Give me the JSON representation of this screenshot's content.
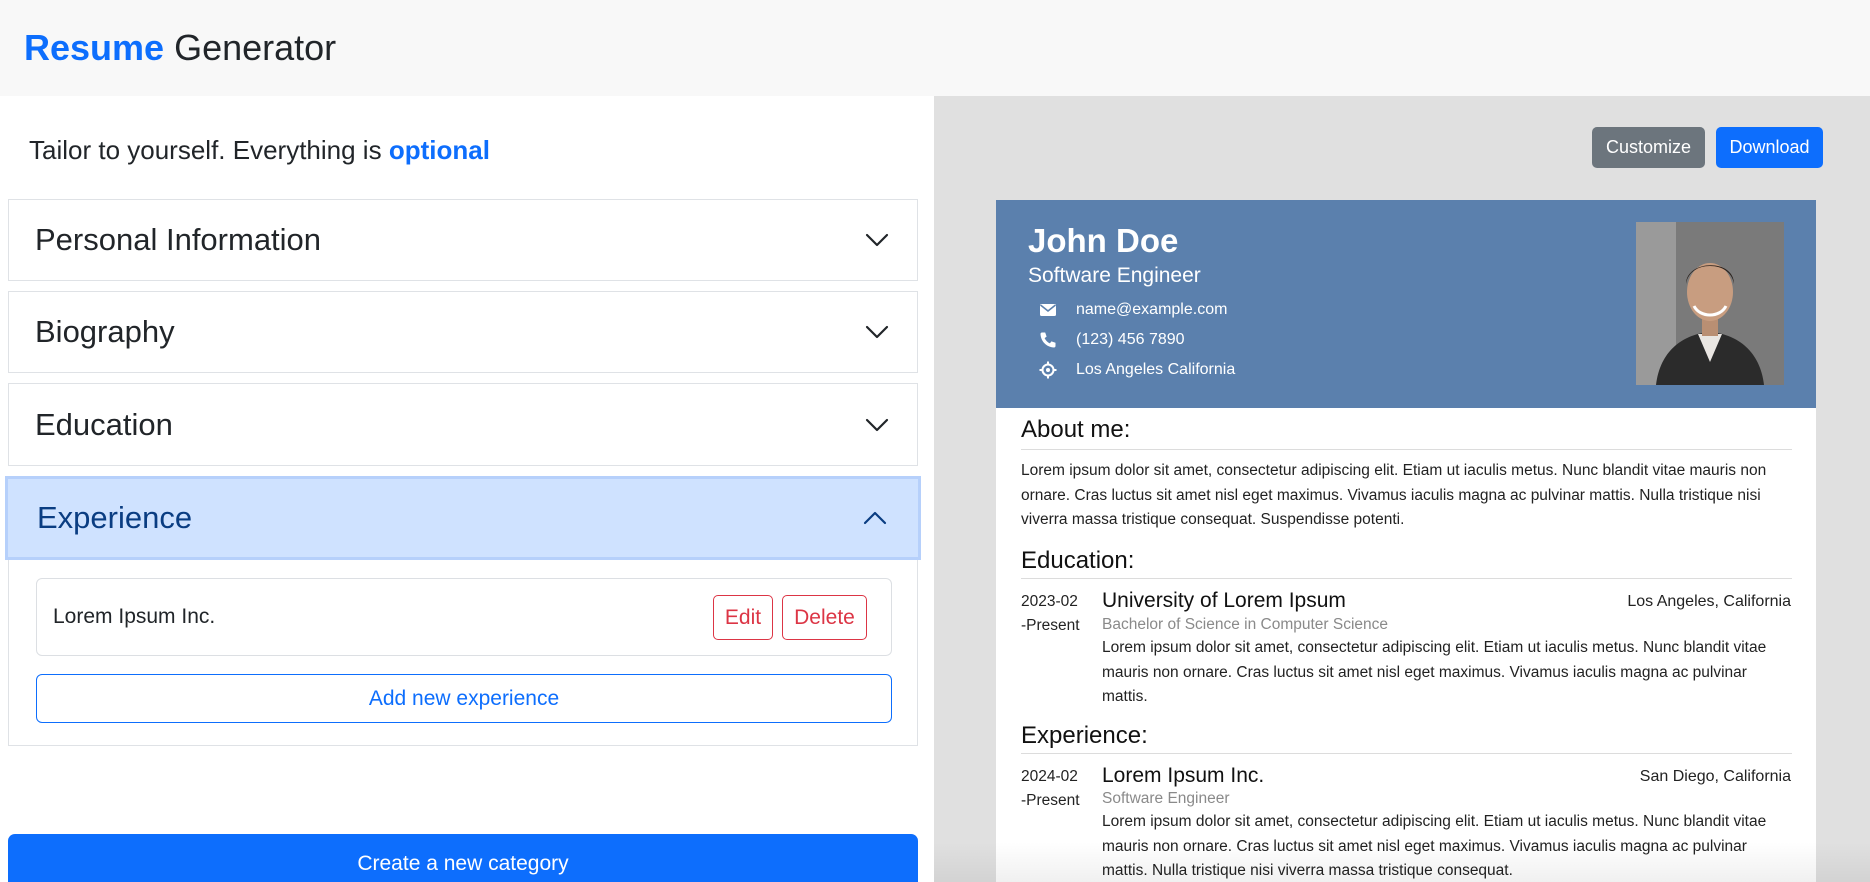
{
  "header": {
    "brand_bold": "Resume",
    "brand_rest": "Generator"
  },
  "editor": {
    "tagline_prefix": "Tailor to yourself. Everything is",
    "tagline_accent": "optional",
    "sections": [
      {
        "label": "Personal Information",
        "expanded": false
      },
      {
        "label": "Biography",
        "expanded": false
      },
      {
        "label": "Education",
        "expanded": false
      },
      {
        "label": "Experience",
        "expanded": true
      }
    ],
    "experience_items": [
      {
        "name": "Lorem Ipsum Inc.",
        "edit_label": "Edit",
        "delete_label": "Delete"
      }
    ],
    "add_experience_label": "Add new experience",
    "create_category_label": "Create a new category"
  },
  "preview": {
    "customize_label": "Customize",
    "download_label": "Download",
    "header_color": "#5b80ad",
    "accent_color": "#0d6efd",
    "resume": {
      "name": "John Doe",
      "role": "Software Engineer",
      "email": "name@example.com",
      "phone": "(123) 456 7890",
      "location": "Los Angeles California",
      "about_title": "About me:",
      "about_text": "Lorem ipsum dolor sit amet, consectetur adipiscing elit. Etiam ut iaculis metus. Nunc blandit vitae mauris non ornare. Cras luctus sit amet nisl eget maximus. Vivamus iaculis magna ac pulvinar mattis. Nulla tristique nisi viverra massa tristique consequat. Suspendisse potenti.",
      "education_title": "Education:",
      "education": [
        {
          "date_start": "2023-02",
          "date_end": "-Present",
          "title": "University of Lorem Ipsum",
          "location": "Los Angeles, California",
          "subtitle": "Bachelor of Science in Computer Science",
          "description": "Lorem ipsum dolor sit amet, consectetur adipiscing elit. Etiam ut iaculis metus. Nunc blandit vitae mauris non ornare. Cras luctus sit amet nisl eget maximus. Vivamus iaculis magna ac pulvinar mattis."
        }
      ],
      "experience_title": "Experience:",
      "experience": [
        {
          "date_start": "2024-02",
          "date_end": "-Present",
          "title": "Lorem Ipsum Inc.",
          "location": "San Diego, California",
          "subtitle": "Software Engineer",
          "description": "Lorem ipsum dolor sit amet, consectetur adipiscing elit. Etiam ut iaculis metus. Nunc blandit vitae mauris non ornare. Cras luctus sit amet nisl eget maximus. Vivamus iaculis magna ac pulvinar mattis. Nulla tristique nisi viverra massa tristique consequat."
        }
      ]
    }
  },
  "icons": {
    "email": "envelope-icon",
    "phone": "phone-icon",
    "location": "crosshair-icon",
    "collapsed": "chevron-down-icon",
    "expanded": "chevron-up-icon"
  }
}
